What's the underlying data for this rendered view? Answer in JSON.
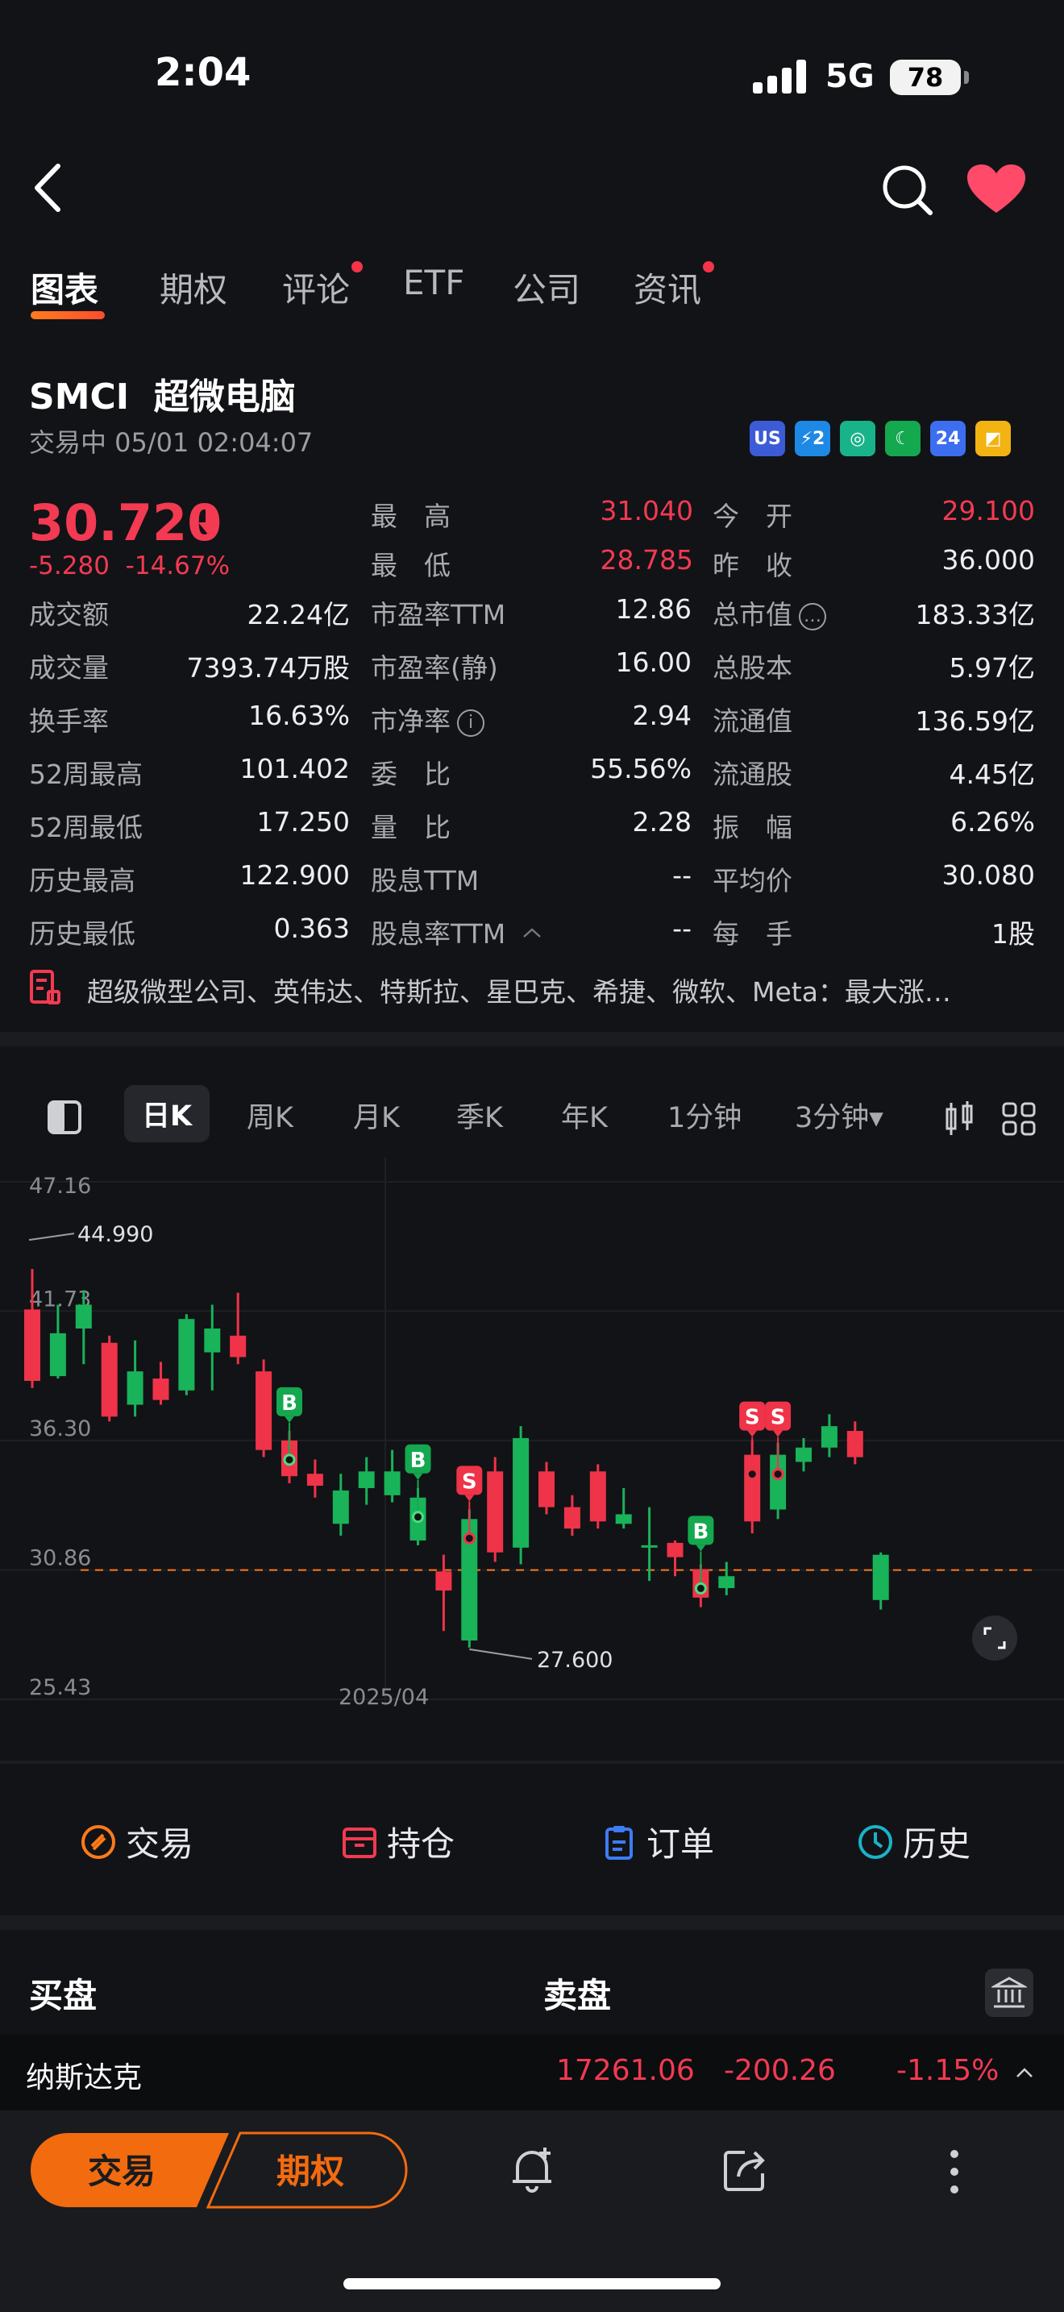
{
  "status": {
    "time": "2:04",
    "network": "5G",
    "battery": "78"
  },
  "tabs": [
    {
      "label": "图表",
      "active": true,
      "dot": false
    },
    {
      "label": "期权",
      "active": false,
      "dot": false
    },
    {
      "label": "评论",
      "active": false,
      "dot": true
    },
    {
      "label": "ETF",
      "active": false,
      "dot": false
    },
    {
      "label": "公司",
      "active": false,
      "dot": false
    },
    {
      "label": "资讯",
      "active": false,
      "dot": true
    }
  ],
  "stock": {
    "symbol": "SMCI",
    "name": "超微电脑",
    "status": "交易中 05/01 02:04:07",
    "price": "30.720",
    "change": "-5.280",
    "change_pct": "-14.67%",
    "badges": [
      {
        "text": "US",
        "color": "#3c5bd6"
      },
      {
        "text": "⚡2",
        "color": "#1e88e5"
      },
      {
        "text": "◎",
        "color": "#19b38a"
      },
      {
        "text": "☾",
        "color": "#14a84f"
      },
      {
        "text": "24",
        "color": "#3d6ef0"
      },
      {
        "text": "◩",
        "color": "#f2b313"
      }
    ]
  },
  "stats": [
    [
      {
        "l": "成交额",
        "v": "22.24亿"
      },
      {
        "l": "市盈率TTM",
        "v": "12.86"
      },
      {
        "l": "总市值",
        "v": "183.33亿",
        "info": "…"
      }
    ],
    [
      {
        "l": "成交量",
        "v": "7393.74万股"
      },
      {
        "l": "市盈率(静)",
        "v": "16.00"
      },
      {
        "l": "总股本",
        "v": "5.97亿"
      }
    ],
    [
      {
        "l": "换手率",
        "v": "16.63%"
      },
      {
        "l": "市净率",
        "v": "2.94",
        "info": "i"
      },
      {
        "l": "流通值",
        "v": "136.59亿"
      }
    ],
    [
      {
        "l": "52周最高",
        "v": "101.402"
      },
      {
        "l": "委　比",
        "v": "55.56%"
      },
      {
        "l": "流通股",
        "v": "4.45亿"
      }
    ],
    [
      {
        "l": "52周最低",
        "v": "17.250"
      },
      {
        "l": "量　比",
        "v": "2.28"
      },
      {
        "l": "振　幅",
        "v": "6.26%"
      }
    ],
    [
      {
        "l": "历史最高",
        "v": "122.900"
      },
      {
        "l": "股息TTM",
        "v": "--"
      },
      {
        "l": "平均价",
        "v": "30.080"
      }
    ],
    [
      {
        "l": "历史最低",
        "v": "0.363"
      },
      {
        "l": "股息率TTM",
        "v": "--"
      },
      {
        "l": "每　手",
        "v": "1股"
      }
    ]
  ],
  "top_stats": {
    "high_label": "最　高",
    "high": "31.040",
    "open_label": "今　开",
    "open": "29.100",
    "low_label": "最　低",
    "low": "28.785",
    "prev_label": "昨　收",
    "prev": "36.000"
  },
  "news": "超级微型公司、英伟达、特斯拉、星巴克、希捷、微软、Meta：最大涨…",
  "chart_tabs": [
    "日K",
    "周K",
    "月K",
    "季K",
    "年K",
    "1分钟",
    "3分钟▾"
  ],
  "chart_data": {
    "type": "candlestick",
    "y_ticks": [
      "47.16",
      "41.73",
      "36.30",
      "30.86",
      "25.43"
    ],
    "ylim": [
      25.43,
      47.16
    ],
    "x_label": "2025/04",
    "max_label": "44.990",
    "min_label": "27.600",
    "current_line": 30.86,
    "candles": [
      {
        "o": 41.8,
        "c": 38.8,
        "h": 43.5,
        "l": 38.5
      },
      {
        "o": 39.0,
        "c": 40.8,
        "h": 42.0,
        "l": 38.9
      },
      {
        "o": 41.0,
        "c": 42.0,
        "h": 42.6,
        "l": 39.5
      },
      {
        "o": 40.4,
        "c": 37.3,
        "h": 40.7,
        "l": 37.1
      },
      {
        "o": 37.8,
        "c": 39.2,
        "h": 40.5,
        "l": 37.3
      },
      {
        "o": 38.9,
        "c": 38.0,
        "h": 39.6,
        "l": 37.8
      },
      {
        "o": 38.4,
        "c": 41.4,
        "h": 41.6,
        "l": 38.2
      },
      {
        "o": 40.0,
        "c": 41.0,
        "h": 42.0,
        "l": 38.4
      },
      {
        "o": 40.7,
        "c": 39.8,
        "h": 42.5,
        "l": 39.5
      },
      {
        "o": 39.2,
        "c": 35.9,
        "h": 39.7,
        "l": 35.6
      },
      {
        "o": 36.3,
        "c": 34.8,
        "h": 36.7,
        "l": 34.5
      },
      {
        "o": 34.9,
        "c": 34.4,
        "h": 35.5,
        "l": 33.9
      },
      {
        "o": 32.8,
        "c": 34.2,
        "h": 34.9,
        "l": 32.3
      },
      {
        "o": 34.3,
        "c": 35.0,
        "h": 35.6,
        "l": 33.6
      },
      {
        "o": 34.0,
        "c": 35.0,
        "h": 35.9,
        "l": 33.7
      },
      {
        "o": 32.1,
        "c": 33.9,
        "h": 34.3,
        "l": 31.9
      },
      {
        "o": 30.8,
        "c": 30.0,
        "h": 31.5,
        "l": 28.3
      },
      {
        "o": 27.9,
        "c": 33.0,
        "h": 33.4,
        "l": 27.6
      },
      {
        "o": 35.0,
        "c": 31.6,
        "h": 35.6,
        "l": 31.2
      },
      {
        "o": 31.8,
        "c": 36.4,
        "h": 36.9,
        "l": 31.1
      },
      {
        "o": 35.0,
        "c": 33.5,
        "h": 35.4,
        "l": 33.2
      },
      {
        "o": 33.5,
        "c": 32.6,
        "h": 34.0,
        "l": 32.3
      },
      {
        "o": 35.0,
        "c": 32.9,
        "h": 35.3,
        "l": 32.6
      },
      {
        "o": 32.8,
        "c": 33.2,
        "h": 34.3,
        "l": 32.6
      },
      {
        "o": 31.8,
        "c": 31.9,
        "h": 33.5,
        "l": 30.4
      },
      {
        "o": 32.0,
        "c": 31.4,
        "h": 32.1,
        "l": 30.6
      },
      {
        "o": 30.9,
        "c": 29.7,
        "h": 31.1,
        "l": 29.3
      },
      {
        "o": 30.1,
        "c": 30.6,
        "h": 31.2,
        "l": 29.8
      },
      {
        "o": 35.7,
        "c": 32.9,
        "h": 36.3,
        "l": 32.4
      },
      {
        "o": 33.4,
        "c": 35.7,
        "h": 36.2,
        "l": 33.0
      },
      {
        "o": 35.4,
        "c": 36.0,
        "h": 36.4,
        "l": 35.0
      },
      {
        "o": 36.0,
        "c": 36.9,
        "h": 37.4,
        "l": 35.6
      },
      {
        "o": 36.7,
        "c": 35.6,
        "h": 37.1,
        "l": 35.3
      },
      {
        "o": 29.6,
        "c": 31.5,
        "h": 31.6,
        "l": 29.2
      }
    ],
    "markers": [
      {
        "i": 10,
        "type": "B"
      },
      {
        "i": 15,
        "type": "B"
      },
      {
        "i": 17,
        "type": "S"
      },
      {
        "i": 26,
        "type": "B"
      },
      {
        "i": 28,
        "type": "S"
      },
      {
        "i": 29,
        "type": "S"
      }
    ]
  },
  "actions": [
    "交易",
    "持仓",
    "订单",
    "历史"
  ],
  "book": {
    "bid": "买盘",
    "ask": "卖盘"
  },
  "index": {
    "name": "纳斯达克",
    "value": "17261.06",
    "change": "-200.26",
    "pct": "-1.15%"
  },
  "bottom": {
    "trade": "交易",
    "options": "期权"
  }
}
